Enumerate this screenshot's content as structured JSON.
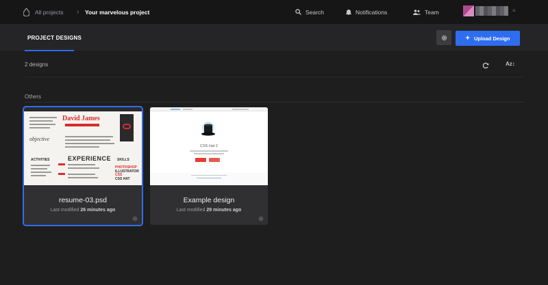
{
  "topbar": {
    "all_projects": "All projects",
    "project_name": "Your marvelous project",
    "nav": {
      "search": "Search",
      "notifications": "Notifications",
      "team": "Team"
    }
  },
  "subheader": {
    "tab": "PROJECT DESIGNS",
    "upload_label": "Upload Design"
  },
  "toolbar": {
    "count": "2 designs",
    "sort_label": "Az↕"
  },
  "section": {
    "title": "Others"
  },
  "designs": [
    {
      "name": "resume-03.psd",
      "modified_prefix": "Last modified",
      "modified_time": "26 minutes ago",
      "selected": true,
      "thumb": {
        "title": "David James",
        "objective": "objective",
        "experience": "EXPERIENCE",
        "skills": "SKILLS",
        "activities": "ACTIVITIES",
        "skill_words": [
          "PHOTOSHOP",
          "ILLUSTRATOR",
          "CSS",
          "CSS HAT"
        ]
      }
    },
    {
      "name": "Example design",
      "modified_prefix": "Last modified",
      "modified_time": "29 minutes ago",
      "selected": false,
      "thumb": {
        "title": "CSS Hat 2"
      }
    }
  ],
  "colors": {
    "accent": "#2f6df0",
    "background": "#1e1e1f",
    "topbar": "#161617"
  },
  "icons": [
    "drop-icon",
    "search-icon",
    "bell-icon",
    "team-icon",
    "gear-icon",
    "plus-icon",
    "refresh-icon"
  ]
}
